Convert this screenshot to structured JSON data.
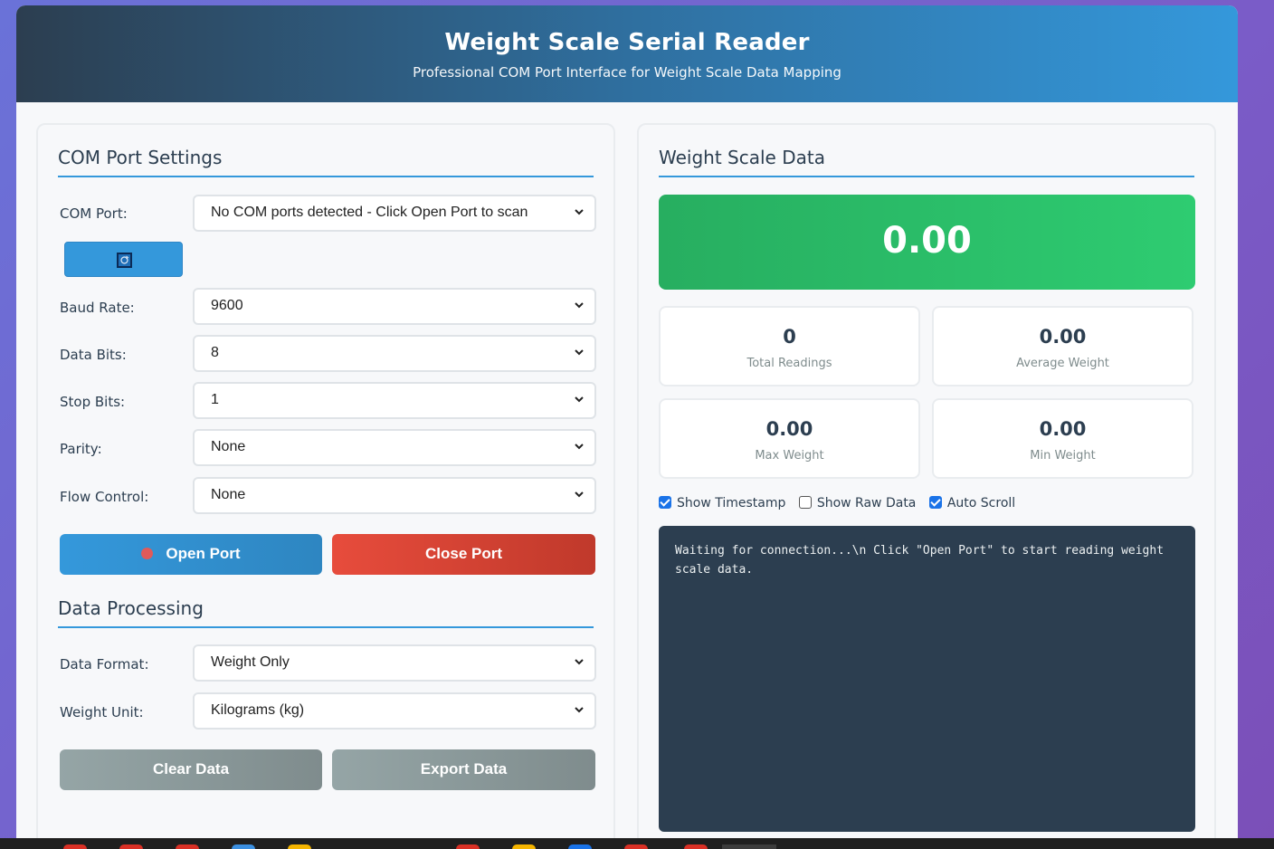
{
  "header": {
    "title": "Weight Scale Serial Reader",
    "subtitle": "Professional COM Port Interface for Weight Scale Data Mapping"
  },
  "com_settings": {
    "title": "COM Port Settings",
    "com_port_label": "COM Port:",
    "com_port_value": "No COM ports detected - Click Open Port to scan",
    "refresh_icon": "refresh-icon",
    "baud_rate_label": "Baud Rate:",
    "baud_rate_value": "9600",
    "data_bits_label": "Data Bits:",
    "data_bits_value": "8",
    "stop_bits_label": "Stop Bits:",
    "stop_bits_value": "1",
    "parity_label": "Parity:",
    "parity_value": "None",
    "flow_control_label": "Flow Control:",
    "flow_control_value": "None",
    "open_port_label": "Open Port",
    "close_port_label": "Close Port"
  },
  "data_processing": {
    "title": "Data Processing",
    "data_format_label": "Data Format:",
    "data_format_value": "Weight Only",
    "weight_unit_label": "Weight Unit:",
    "weight_unit_value": "Kilograms (kg)",
    "clear_label": "Clear Data",
    "export_label": "Export Data"
  },
  "scale_data": {
    "title": "Weight Scale Data",
    "current_weight": "0.00",
    "stats": [
      {
        "value": "0",
        "label": "Total Readings"
      },
      {
        "value": "0.00",
        "label": "Average Weight"
      },
      {
        "value": "0.00",
        "label": "Max Weight"
      },
      {
        "value": "0.00",
        "label": "Min Weight"
      }
    ],
    "options": [
      {
        "label": "Show Timestamp",
        "checked": true
      },
      {
        "label": "Show Raw Data",
        "checked": false
      },
      {
        "label": "Auto Scroll",
        "checked": true
      }
    ],
    "log_text": "Waiting for connection...\\n Click \"Open Port\" to start reading weight scale data."
  },
  "colors": {
    "accent": "#3498db",
    "success": "#2ecc71",
    "danger": "#e74c3c",
    "neutral": "#95a5a6",
    "dark": "#2c3e50"
  }
}
